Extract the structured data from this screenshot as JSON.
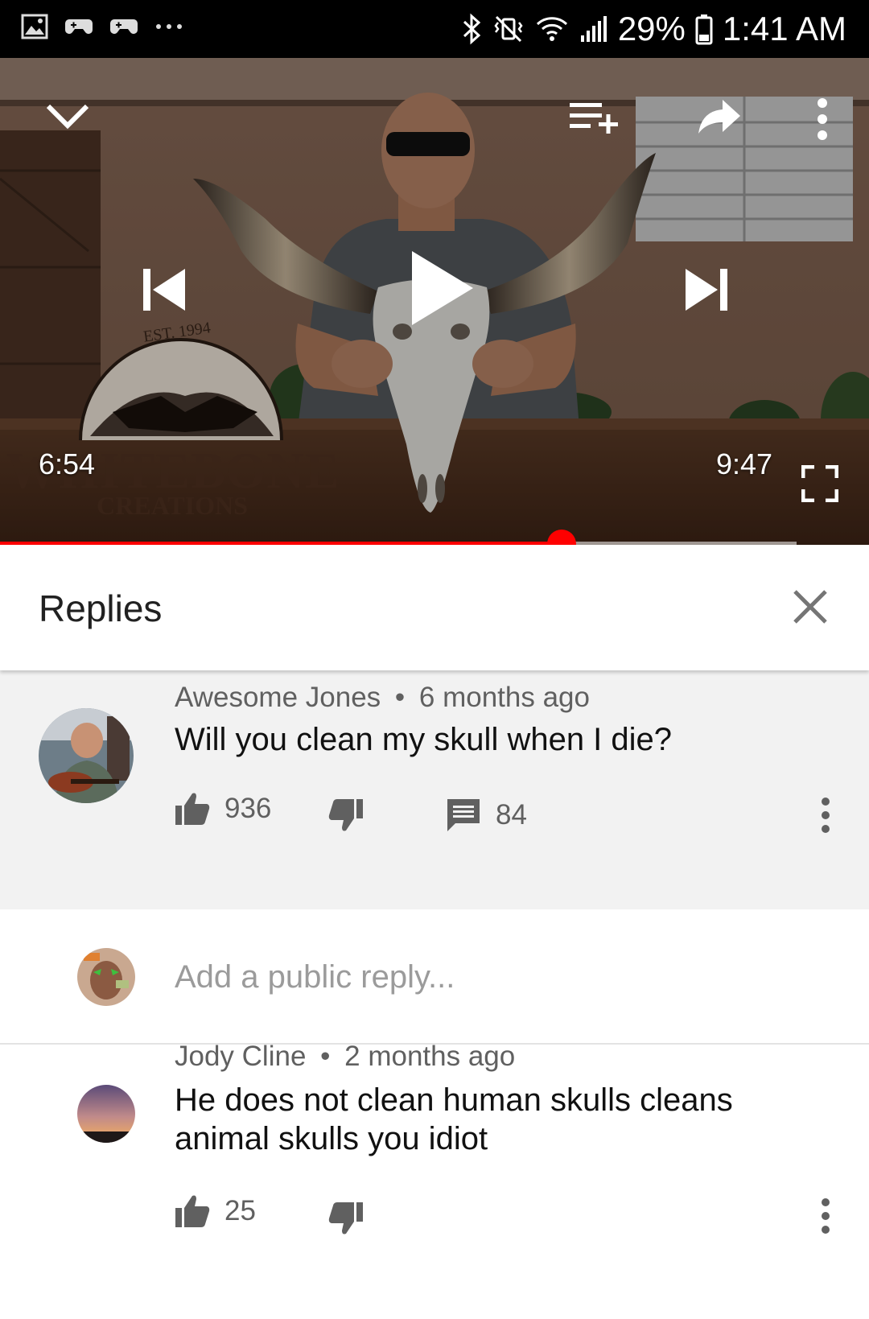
{
  "status_bar": {
    "battery": "29%",
    "time": "1:41 AM",
    "left_icons": [
      "gallery-icon",
      "gamepad-icon",
      "gamepad-icon",
      "more-horiz-icon"
    ],
    "right_icons": [
      "bluetooth-icon",
      "vibrate-mute-icon",
      "wifi-icon",
      "signal-icon",
      "battery-icon"
    ]
  },
  "player": {
    "elapsed": "6:54",
    "duration": "9:47",
    "progress": 0.705,
    "watermark_year": "EST. 1994",
    "watermark_name": "WHITEBONE",
    "watermark_sub": "CREATIONS",
    "accent": "#ff0000"
  },
  "replies_panel": {
    "title": "Replies"
  },
  "comment": {
    "author": "Awesome Jones",
    "separator": "•",
    "age": "6 months ago",
    "text": "Will you clean my skull when I die?",
    "likes": "936",
    "reply_count": "84"
  },
  "add_reply": {
    "placeholder": "Add a public reply..."
  },
  "reply": {
    "author": "Jody Cline",
    "separator": "•",
    "age": "2 months ago",
    "text": "He does not clean human skulls cleans animal skulls you idiot",
    "likes": "25"
  }
}
